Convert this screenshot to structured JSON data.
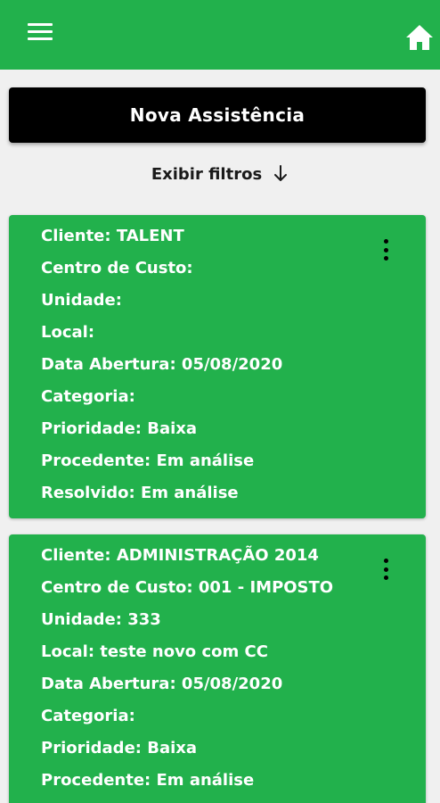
{
  "header": {
    "menu_icon": "hamburger-menu-icon",
    "home_icon": "home-icon",
    "background": "#22b14c"
  },
  "actions": {
    "new_label": "Nova Assistência",
    "filters_label": "Exibir filtros",
    "filters_icon": "arrow-down-icon"
  },
  "cards": [
    {
      "rows": [
        "Cliente: TALENT",
        "Centro de Custo:",
        "Unidade:",
        "Local:",
        "Data Abertura: 05/08/2020",
        "Categoria:",
        "Prioridade: Baixa",
        "Procedente: Em análise",
        "Resolvido: Em análise"
      ]
    },
    {
      "rows": [
        "Cliente: ADMINISTRAÇÃO 2014",
        "Centro de Custo: 001 - IMPOSTO",
        "Unidade: 333",
        "Local: teste novo com CC",
        "Data Abertura: 05/08/2020",
        "Categoria:",
        "Prioridade: Baixa",
        "Procedente: Em análise"
      ]
    }
  ],
  "colors": {
    "accent": "#22b14c",
    "button": "#000000",
    "background": "#f0f0f0"
  }
}
